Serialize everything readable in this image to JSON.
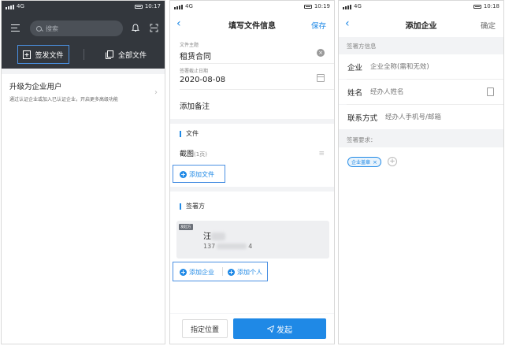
{
  "colors": {
    "accent": "#1f89e6",
    "dark_header": "#33373d",
    "highlight_outline": "#4a90e2"
  },
  "screens": {
    "home": {
      "status": {
        "time": "10:17",
        "signal": "4G"
      },
      "search_placeholder": "搜索",
      "sign_button": "签发文件",
      "all_docs_button": "全部文件",
      "upgrade_title": "升级为企业用户",
      "upgrade_desc": "通过认证企业或加入已认证企业，开启更多高级功能"
    },
    "fill_info": {
      "status": {
        "time": "10:19",
        "signal": "4G"
      },
      "title": "填写文件信息",
      "save": "保存",
      "subject_label": "文件主题",
      "subject_value": "租赁合同",
      "deadline_label": "签署截止日期",
      "deadline_value": "2020-08-08",
      "add_note": "添加备注",
      "file_section": "文件",
      "file_name": "截图",
      "file_pages": "(1页)",
      "add_file": "添加文件",
      "signers_section": "签署方",
      "signer": {
        "tag": "发起方",
        "name": "汪",
        "phone_prefix": "137",
        "phone_suffix": "4"
      },
      "add_company": "添加企业",
      "add_person": "添加个人",
      "set_position": "指定位置",
      "send": "发起"
    },
    "add_company": {
      "status": {
        "time": "10:18",
        "signal": "4G"
      },
      "title": "添加企业",
      "confirm": "确定",
      "signer_info_label": "签署方信息",
      "company_label": "企业",
      "company_placeholder": "企业全称(需和无效)",
      "name_label": "姓名",
      "name_placeholder": "经办人姓名",
      "contact_label": "联系方式",
      "contact_placeholder": "经办人手机号/邮箱",
      "requirements_label": "签署要求：",
      "chip_label": "企业盖章"
    }
  }
}
